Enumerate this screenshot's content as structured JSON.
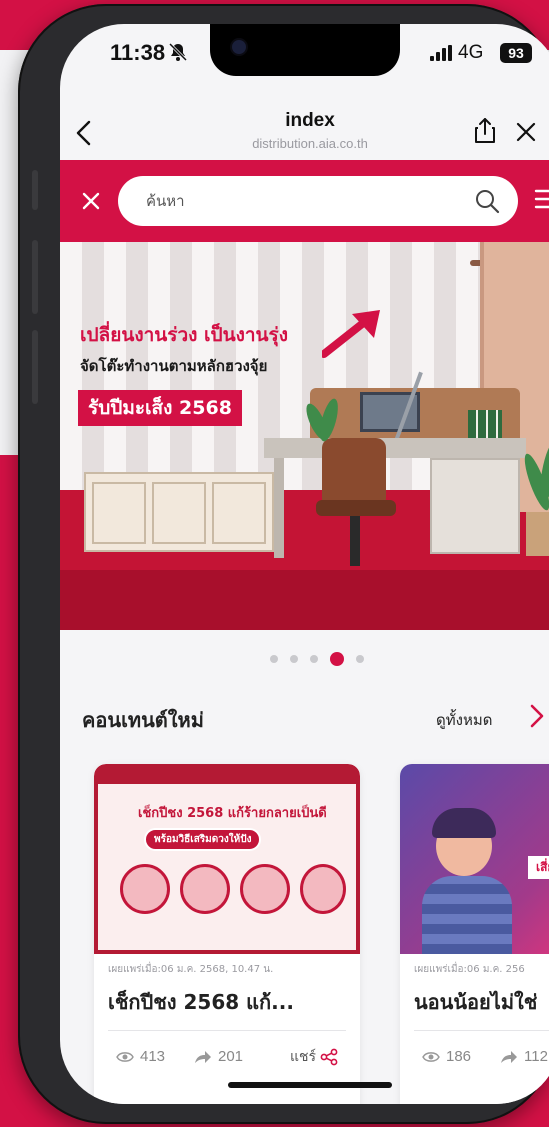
{
  "status_bar": {
    "time": "11:38",
    "network": "4G",
    "battery": "93",
    "icons": [
      "bell-slash-icon",
      "signal-icon"
    ]
  },
  "browser": {
    "title": "index",
    "url": "distribution.aia.co.th",
    "icons": [
      "back-icon",
      "share-icon",
      "close-icon"
    ]
  },
  "search": {
    "placeholder": "ค้นหา",
    "icons": [
      "close-icon",
      "search-icon",
      "menu-icon"
    ]
  },
  "banner": {
    "line1": "เปลี่ยนงานร่วง เป็นงานรุ่ง",
    "line2": "จัดโต๊ะทำงานตามหลักฮวงจุ้ย",
    "line3": "รับปีมะเส็ง 2568"
  },
  "carousel": {
    "count": 5,
    "active_index": 3
  },
  "section": {
    "title": "คอนเทนต์ใหม่",
    "see_all": "ดูทั้งหมด"
  },
  "cards": [
    {
      "thumb_title": "เช็กปีชง 2568 แก้ร้ายกลายเป็นดี",
      "thumb_subtitle": "พร้อมวิธีเสริมดวงให้ปัง",
      "date": "เผยแพร่เมื่อ:06 ม.ค. 2568, 10.47 น.",
      "title": "เช็กปีชง 2568 แก้...",
      "views": "413",
      "shares": "201",
      "share_label": "แชร์"
    },
    {
      "thumb_tag": "เสี่ยงต",
      "date": "เผยแพร่เมื่อ:06 ม.ค. 256",
      "title": "นอนน้อยไม่ใช่",
      "views": "186",
      "shares": "112"
    }
  ],
  "colors": {
    "brand_red": "#d31145",
    "text_dark": "#222222",
    "text_muted": "#9a9aa0"
  }
}
